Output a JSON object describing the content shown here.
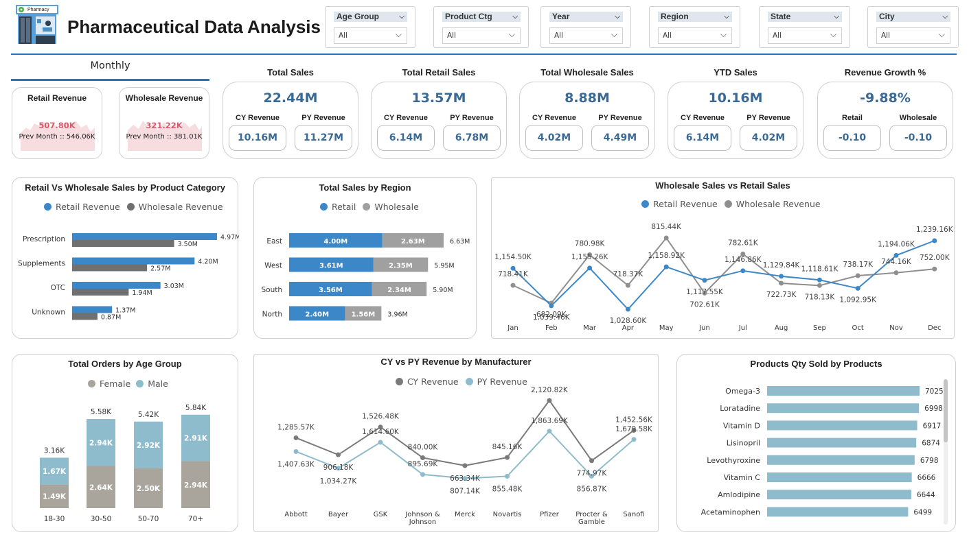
{
  "header": {
    "title": "Pharmaceutical Data Analysis",
    "logo_text": "Pharmacy",
    "filters": [
      {
        "label": "Age Group",
        "value": "All"
      },
      {
        "label": "Product Ctg",
        "value": "All"
      },
      {
        "label": "Year",
        "value": "All"
      },
      {
        "label": "Region",
        "value": "All"
      },
      {
        "label": "State",
        "value": "All"
      },
      {
        "label": "City",
        "value": "All"
      }
    ]
  },
  "monthly": {
    "tab_label": "Monthly",
    "retail": {
      "title": "Retail Revenue",
      "value": "507.80K",
      "prev": "Prev Month :: 546.06K"
    },
    "wholesale": {
      "title": "Wholesale Revenue",
      "value": "321.22K",
      "prev": "Prev Month :: 381.01K"
    }
  },
  "kpis": [
    {
      "title": "Total Sales",
      "value": "22.44M",
      "left_label": "CY Revenue",
      "left_value": "10.16M",
      "right_label": "PY Revenue",
      "right_value": "11.27M"
    },
    {
      "title": "Total Retail Sales",
      "value": "13.57M",
      "left_label": "CY Revenue",
      "left_value": "6.14M",
      "right_label": "PY Revenue",
      "right_value": "6.78M"
    },
    {
      "title": "Total Wholesale Sales",
      "value": "8.88M",
      "left_label": "CY Revenue",
      "left_value": "4.02M",
      "right_label": "PY Revenue",
      "right_value": "4.49M"
    },
    {
      "title": "YTD Sales",
      "value": "10.16M",
      "left_label": "CY Revenue",
      "left_value": "6.14M",
      "right_label": "PY Revenue",
      "right_value": "4.02M"
    },
    {
      "title": "Revenue Growth %",
      "value": "-9.88%",
      "left_label": "Retail",
      "left_value": "-0.10",
      "right_label": "Wholesale",
      "right_value": "-0.10"
    }
  ],
  "colors": {
    "accent": "#2e74b5",
    "blue": "#3b87c8",
    "gray": "#8f8f8f",
    "kpi_value": "#3a6a94",
    "light_blue": "#8fbccc",
    "taupe": "#a9a49c",
    "red": "#e0566a"
  },
  "chart_data": [
    {
      "type": "bar",
      "title": "Retail Vs Wholesale Sales by Product Category",
      "categories": [
        "Prescription",
        "Supplements",
        "OTC",
        "Unknown"
      ],
      "series": [
        {
          "name": "Retail Revenue",
          "values": [
            4.97,
            4.2,
            3.03,
            1.37
          ],
          "labels": [
            "4.97M",
            "4.20M",
            "3.03M",
            "1.37M"
          ]
        },
        {
          "name": "Wholesale Revenue",
          "values": [
            3.5,
            2.57,
            1.94,
            0.87
          ],
          "labels": [
            "3.50M",
            "2.57M",
            "1.94M",
            "0.87M"
          ]
        }
      ]
    },
    {
      "type": "bar",
      "title": "Total Sales by Region",
      "categories": [
        "East",
        "West",
        "South",
        "North"
      ],
      "series": [
        {
          "name": "Retail",
          "values": [
            4.0,
            3.61,
            3.56,
            2.4
          ],
          "labels": [
            "4.00M",
            "3.61M",
            "3.56M",
            "2.40M"
          ]
        },
        {
          "name": "Wholesale",
          "values": [
            2.63,
            2.35,
            2.34,
            1.56
          ],
          "labels": [
            "2.63M",
            "2.35M",
            "2.34M",
            "1.56M"
          ]
        }
      ],
      "totals": [
        "6.63M",
        "5.95M",
        "5.90M",
        "3.96M"
      ]
    },
    {
      "type": "line",
      "title": "Wholesale Sales vs Retail Sales",
      "categories": [
        "Jan",
        "Feb",
        "Mar",
        "Apr",
        "May",
        "Jun",
        "Jul",
        "Aug",
        "Sep",
        "Oct",
        "Nov",
        "Dec"
      ],
      "series": [
        {
          "name": "Retail Revenue",
          "values": [
            1154.5,
            1039.46,
            1155.26,
            1028.6,
            1158.92,
            1117.55,
            1146.86,
            1129.84,
            1118.61,
            1092.95,
            1194.06,
            1239.16
          ],
          "labels": [
            "1,154.50K",
            "1,039.46K",
            "1,155.26K",
            "1,028.60K",
            "1,158.92K",
            "1,117.55K",
            "1,146.86K",
            "1,129.84K",
            "1,118.61K",
            "1,092.95K",
            "1,194.06K",
            "1,239.16K"
          ]
        },
        {
          "name": "Wholesale Revenue",
          "values": [
            718.41,
            682.09,
            780.98,
            718.37,
            815.44,
            702.61,
            782.61,
            722.73,
            718.13,
            738.17,
            744.16,
            752.0
          ],
          "labels": [
            "718.41K",
            "682.09K",
            "780.98K",
            "718.37K",
            "815.44K",
            "702.61K",
            "782.61K",
            "722.73K",
            "718.13K",
            "738.17K",
            "744.16K",
            "752.00K"
          ]
        }
      ]
    },
    {
      "type": "bar",
      "title": "Total Orders by Age Group",
      "categories": [
        "18-30",
        "30-50",
        "50-70",
        "70+"
      ],
      "series": [
        {
          "name": "Female",
          "values": [
            1.49,
            2.64,
            2.5,
            2.94
          ],
          "labels": [
            "1.49K",
            "2.64K",
            "2.50K",
            "2.94K"
          ]
        },
        {
          "name": "Male",
          "values": [
            1.67,
            2.94,
            2.92,
            2.91
          ],
          "labels": [
            "1.67K",
            "2.94K",
            "2.92K",
            "2.91K"
          ]
        }
      ],
      "totals": [
        "3.16K",
        "5.58K",
        "5.42K",
        "5.84K"
      ]
    },
    {
      "type": "line",
      "title": "CY vs PY Revenue by Manufacturer",
      "categories": [
        "Abbott",
        "Bayer",
        "GSK",
        "Johnson & Johnson",
        "Merck",
        "Novartis",
        "Pfizer",
        "Procter & Gamble",
        "Sanofi"
      ],
      "series": [
        {
          "name": "CY Revenue",
          "values": [
            1285.57,
            906.18,
            1526.48,
            840.0,
            663.34,
            845.16,
            2120.82,
            774.97,
            1452.56
          ],
          "labels": [
            "1,285.57K",
            "906.18K",
            "1,526.48K",
            "840.00K",
            "663.34K",
            "845.16K",
            "2,120.82K",
            "774.97K",
            "1,452.56K"
          ]
        },
        {
          "name": "PY Revenue",
          "values": [
            1407.63,
            1034.27,
            1614.6,
            895.69,
            807.14,
            855.48,
            1863.69,
            856.87,
            1679.58
          ],
          "labels": [
            "1,407.63K",
            "1,034.27K",
            "1,614.60K",
            "895.69K",
            "807.14K",
            "855.48K",
            "1,863.69K",
            "856.87K",
            "1,679.58K"
          ]
        }
      ]
    },
    {
      "type": "bar",
      "title": "Products Qty Sold by Products",
      "categories": [
        "Omega-3",
        "Loratadine",
        "Vitamin D",
        "Lisinopril",
        "Levothyroxine",
        "Vitamin C",
        "Amlodipine",
        "Acetaminophen"
      ],
      "values": [
        7025,
        6998,
        6917,
        6874,
        6798,
        6666,
        6644,
        6499
      ]
    }
  ]
}
